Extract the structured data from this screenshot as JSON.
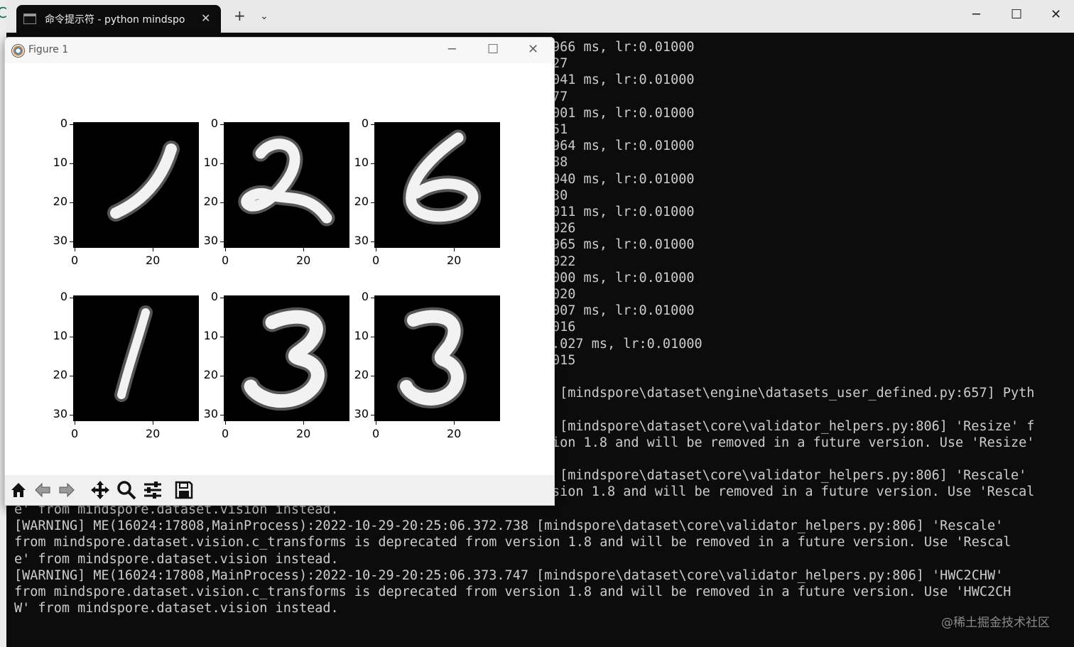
{
  "terminal": {
    "tab_title": "命令提示符 - python  mindspo",
    "tab_close": "✕",
    "new_tab": "+",
    "dropdown": "⌄",
    "controls": {
      "minimize": "─",
      "maximize": "☐",
      "close": "✕"
    },
    "lines_right": [
      "966 ms, lr:0.01000",
      "27",
      "041 ms, lr:0.01000",
      "77",
      "001 ms, lr:0.01000",
      "51",
      "964 ms, lr:0.01000",
      "88",
      "040 ms, lr:0.01000",
      "30",
      "011 ms, lr:0.01000",
      "026",
      "965 ms, lr:0.01000",
      "022",
      "000 ms, lr:0.01000",
      "020",
      "007 ms, lr:0.01000",
      "016",
      ".027 ms, lr:0.01000",
      "015",
      "",
      " [mindspore\\dataset\\engine\\datasets_user_defined.py:657] Pyth",
      "",
      " [mindspore\\dataset\\core\\validator_helpers.py:806] 'Resize' f",
      "ion 1.8 and will be removed in a future version. Use 'Resize'",
      "",
      " [mindspore\\dataset\\core\\validator_helpers.py:806] 'Rescale'",
      "sion 1.8 and will be removed in a future version. Use 'Rescal"
    ],
    "lines_full": [
      "e' from mindspore.dataset.vision instead.",
      "[WARNING] ME(16024:17808,MainProcess):2022-10-29-20:25:06.372.738 [mindspore\\dataset\\core\\validator_helpers.py:806] 'Rescale'",
      "from mindspore.dataset.vision.c_transforms is deprecated from version 1.8 and will be removed in a future version. Use 'Rescal",
      "e' from mindspore.dataset.vision instead.",
      "[WARNING] ME(16024:17808,MainProcess):2022-10-29-20:25:06.373.747 [mindspore\\dataset\\core\\validator_helpers.py:806] 'HWC2CHW'",
      "from mindspore.dataset.vision.c_transforms is deprecated from version 1.8 and will be removed in a future version. Use 'HWC2CH",
      "W' from mindspore.dataset.vision instead."
    ],
    "watermark": "@稀土掘金技术社区"
  },
  "figure": {
    "title": "Figure 1",
    "controls": {
      "minimize": "─",
      "maximize": "☐",
      "close": "✕"
    },
    "y_ticks": [
      "0",
      "10",
      "20",
      "30"
    ],
    "x_ticks": [
      "0",
      "20"
    ],
    "digits": [
      "1",
      "2",
      "6",
      "1",
      "3",
      "3"
    ],
    "toolbar_icons": [
      "home-icon",
      "back-arrow-icon",
      "forward-arrow-icon",
      "pan-icon",
      "zoom-icon",
      "configure-icon",
      "save-icon"
    ]
  },
  "left_edge_glyph": "C"
}
